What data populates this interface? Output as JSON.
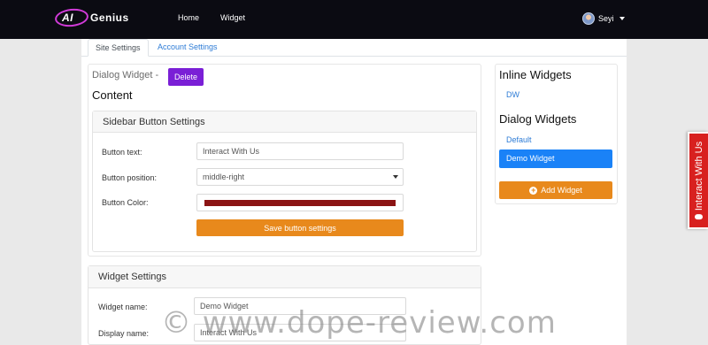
{
  "navbar": {
    "logo_ai": "AI",
    "logo_text": "Genius",
    "links": [
      "Home",
      "Widget"
    ],
    "user_name": "Seyi"
  },
  "tabs": [
    "Site Settings",
    "Account Settings"
  ],
  "main": {
    "dialog_title": "Dialog Widget -",
    "delete_label": "Delete",
    "content_heading": "Content",
    "sidebar_button_settings": {
      "header": "Sidebar Button Settings",
      "button_text_label": "Button text:",
      "button_text_value": "Interact With Us",
      "button_position_label": "Button position:",
      "button_position_value": "middle-right",
      "button_color_label": "Button Color:",
      "button_color_value": "#8b1414",
      "save_label": "Save button settings"
    },
    "widget_settings": {
      "header": "Widget Settings",
      "widget_name_label": "Widget name:",
      "widget_name_value": "Demo Widget",
      "display_name_label": "Display name:",
      "display_name_value": "Interact With Us"
    }
  },
  "side": {
    "inline_heading": "Inline Widgets",
    "inline_items": [
      "DW"
    ],
    "dialog_heading": "Dialog Widgets",
    "dialog_items": [
      "Default",
      "Demo Widget"
    ],
    "add_widget_label": "Add Widget"
  },
  "interact_tab_label": "Interact With Us",
  "watermark": "© www.dope-review.com",
  "colors": {
    "navbar": "#0b0b12",
    "delete": "#7a1fd6",
    "primary": "#1a82f7",
    "orange": "#e8891c",
    "link": "#2e7cd6",
    "interact_tab": "#d8201f"
  }
}
